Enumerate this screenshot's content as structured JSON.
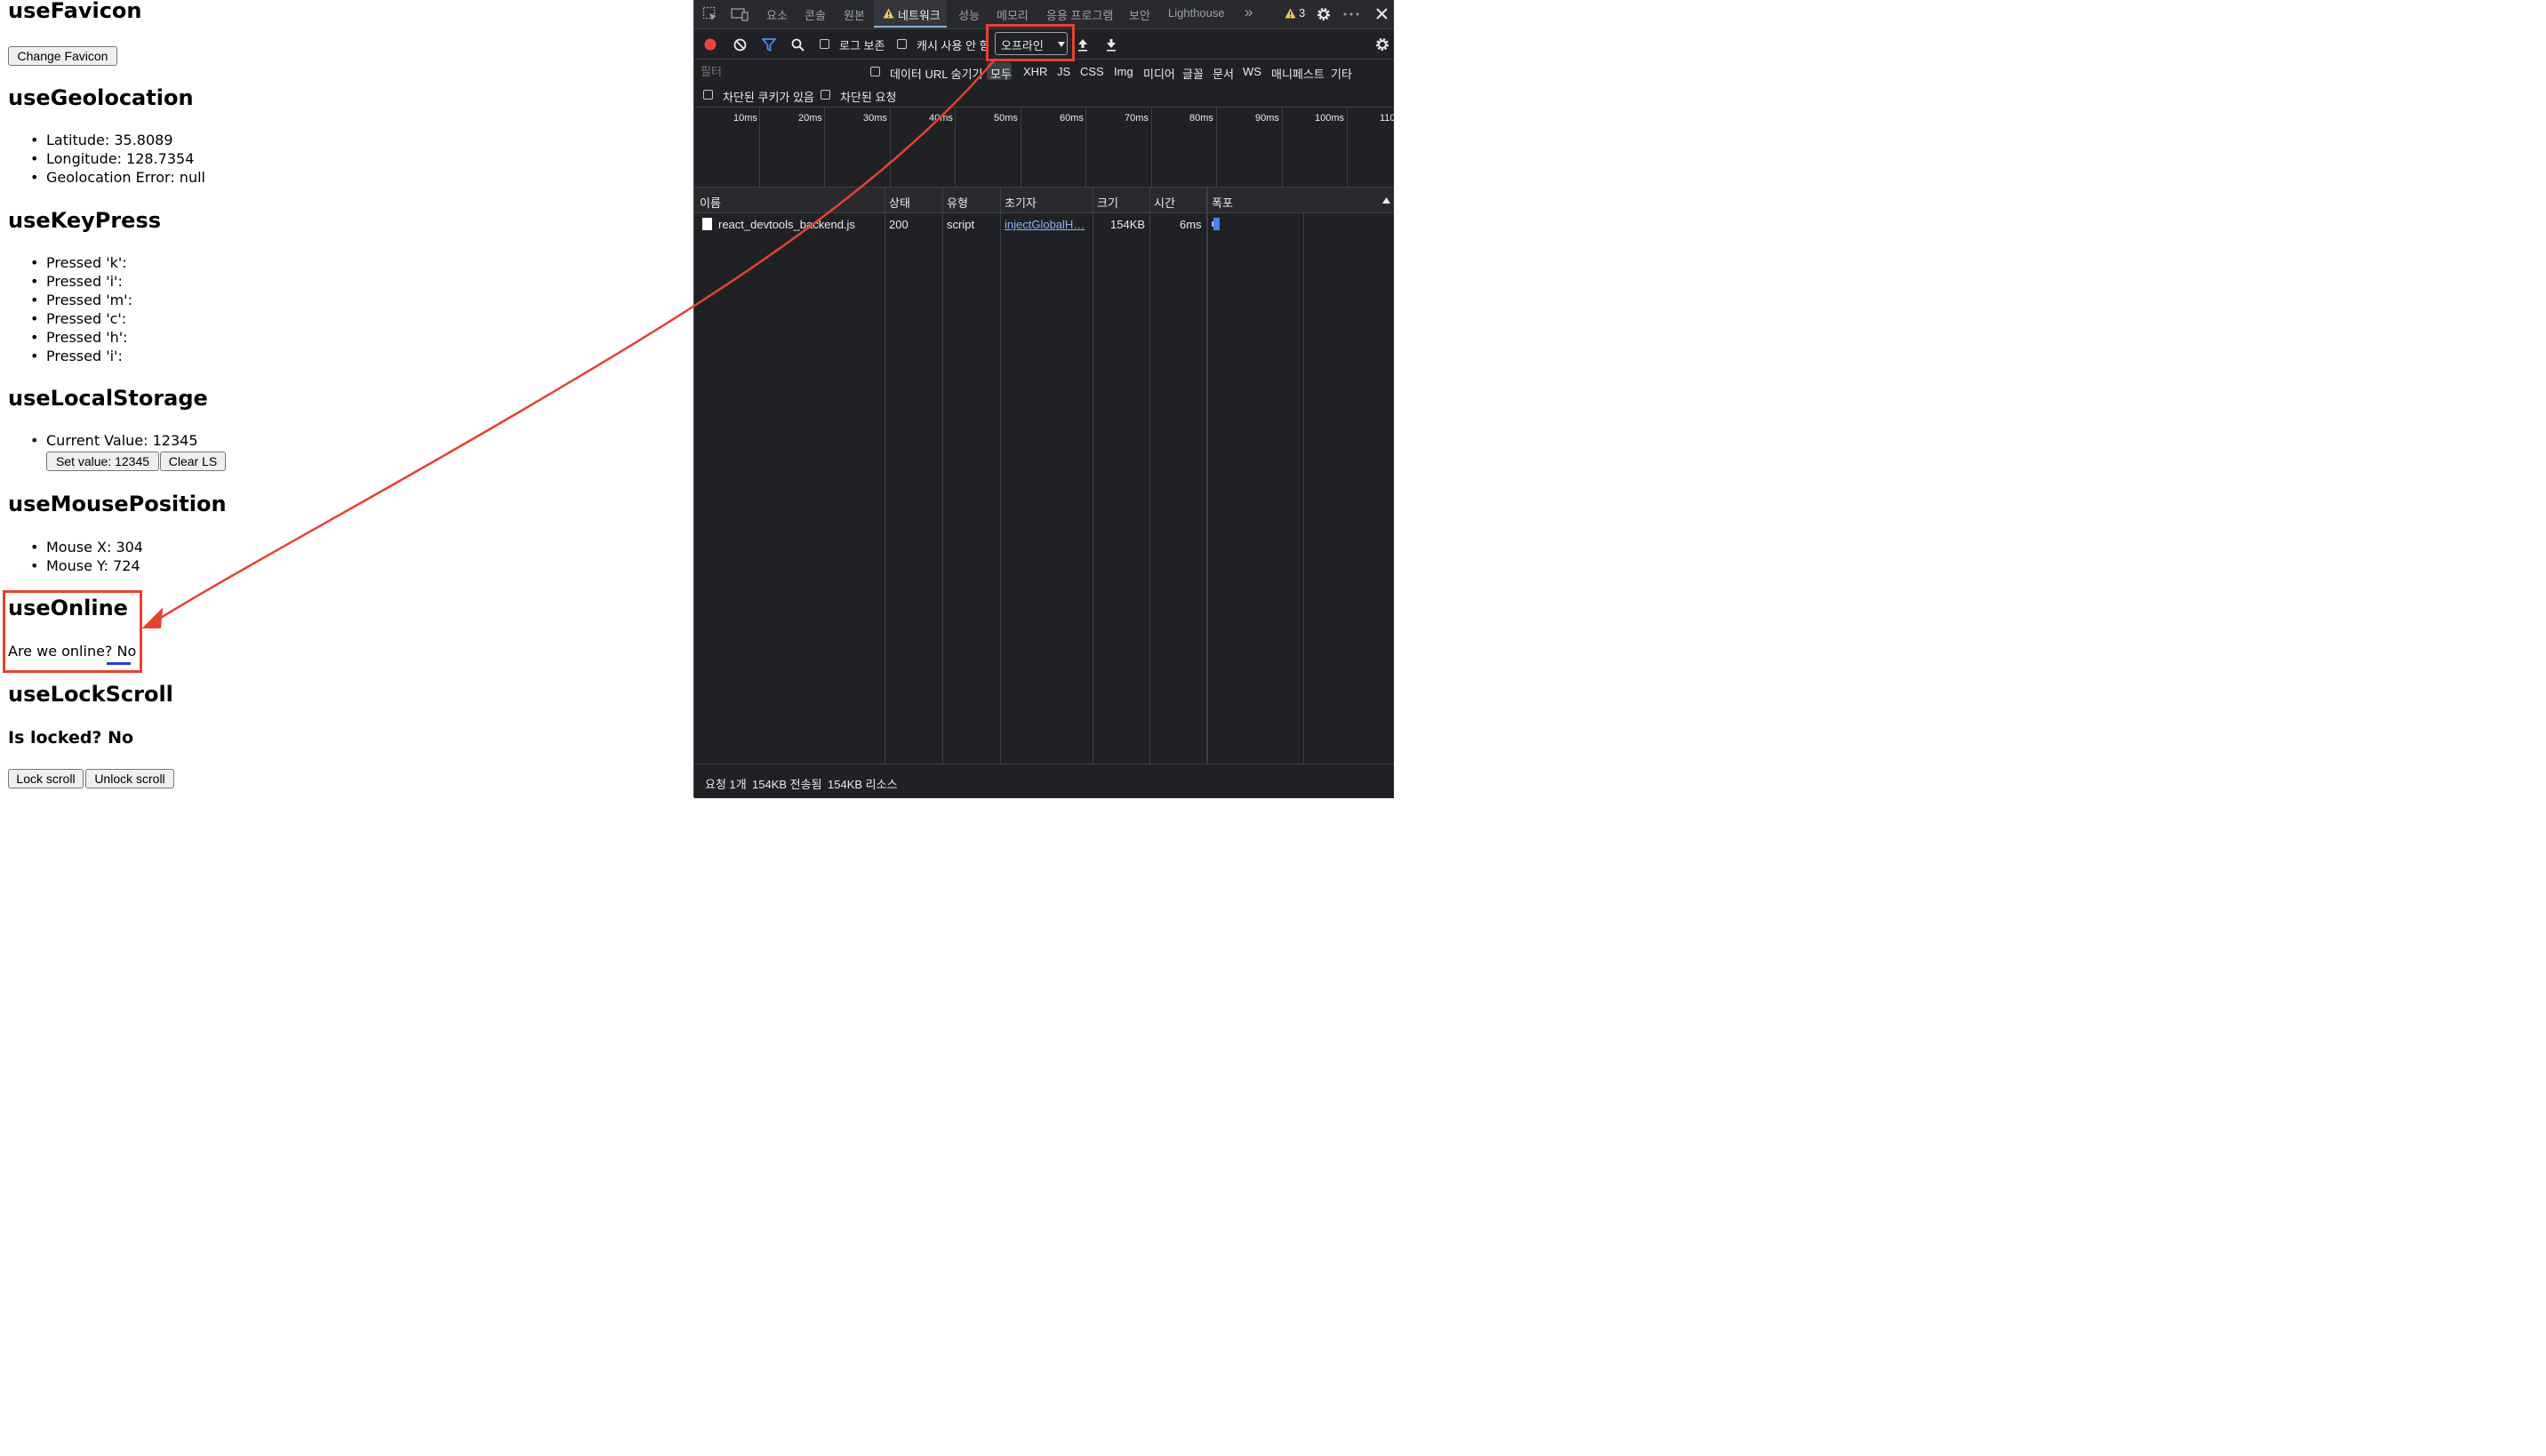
{
  "left": {
    "favicon": {
      "title": "useFavicon",
      "button": "Change Favicon"
    },
    "geolocation": {
      "title": "useGeolocation",
      "items": [
        "Latitude: 35.8089",
        "Longitude: 128.7354",
        "Geolocation Error: null"
      ]
    },
    "keypress": {
      "title": "useKeyPress",
      "items": [
        "Pressed 'k':",
        "Pressed 'i':",
        "Pressed 'm':",
        "Pressed 'c':",
        "Pressed 'h':",
        "Pressed 'i':"
      ]
    },
    "localstorage": {
      "title": "useLocalStorage",
      "item": "Current Value: 12345",
      "set_button": "Set value: 12345",
      "clear_button": "Clear LS"
    },
    "mouse": {
      "title": "useMousePosition",
      "items": [
        "Mouse X: 304",
        "Mouse Y: 724"
      ]
    },
    "online": {
      "title": "useOnline",
      "text": "Are we online? No"
    },
    "lockscroll": {
      "title": "useLockScroll",
      "status": "Is locked? No",
      "lock_button": "Lock scroll",
      "unlock_button": "Unlock scroll"
    }
  },
  "devtools": {
    "tabs": [
      "요소",
      "콘솔",
      "원본",
      "네트워크",
      "성능",
      "메모리",
      "응용 프로그램",
      "보안",
      "Lighthouse"
    ],
    "active_tab": "네트워크",
    "more_tabs": "»",
    "warning_count": "3",
    "toolbar": {
      "preserve_log": "로그 보존",
      "disable_cache": "캐시 사용 안 함",
      "throttle_value": "오프라인"
    },
    "filter": {
      "placeholder": "필터",
      "hide_data_urls": "데이터 URL 숨기기",
      "types": [
        "모두",
        "XHR",
        "JS",
        "CSS",
        "Img",
        "미디어",
        "글꼴",
        "문서",
        "WS",
        "매니페스트",
        "기타"
      ],
      "blocked_cookies": "차단된 쿠키가 있음",
      "blocked_requests": "차단된 요청"
    },
    "timeline_ticks": [
      "10ms",
      "20ms",
      "30ms",
      "40ms",
      "50ms",
      "60ms",
      "70ms",
      "80ms",
      "90ms",
      "100ms",
      "110"
    ],
    "columns": [
      "이름",
      "상태",
      "유형",
      "초기자",
      "크기",
      "시간",
      "폭포"
    ],
    "rows": [
      {
        "name": "react_devtools_backend.js",
        "status": "200",
        "type": "script",
        "initiator": "injectGlobalH…",
        "size": "154KB",
        "time": "6ms"
      }
    ],
    "status_bar": {
      "requests": "요청 1개",
      "transferred": "154KB 전송됨",
      "resources": "154KB 리소스"
    }
  },
  "colors": {
    "annotation": "#e8412f",
    "devtools_bg": "#202124",
    "record": "#f44336",
    "link": "#8ab4f8"
  }
}
